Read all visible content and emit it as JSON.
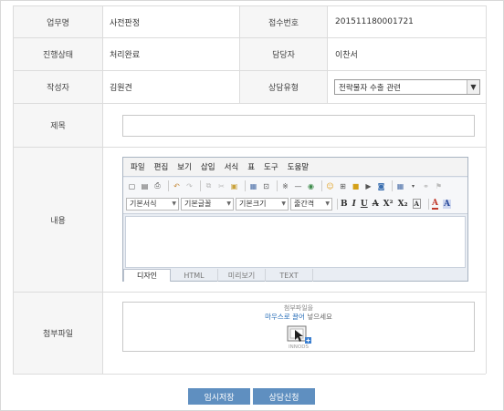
{
  "rows": {
    "work_name": {
      "label": "업무명",
      "value": "사전판정"
    },
    "receipt_no": {
      "label": "접수번호",
      "value": "20151118000172​1"
    },
    "status": {
      "label": "진행상태",
      "value": "처리완료"
    },
    "manager": {
      "label": "담당자",
      "value": "이찬서"
    },
    "writer": {
      "label": "작성자",
      "value": "김원견"
    },
    "consult_type": {
      "label": "상담유형",
      "value": "전략물자 수출 관련"
    },
    "title": {
      "label": "제목",
      "value": ""
    },
    "content": {
      "label": "내용"
    },
    "attach": {
      "label": "첨부파일"
    }
  },
  "editor": {
    "menu": [
      "파일",
      "편집",
      "보기",
      "삽입",
      "서식",
      "표",
      "도구",
      "도움말"
    ],
    "format_select": "기본서식",
    "font_select": "기본글꼴",
    "size_select": "기본크기",
    "line_select": "줄간격",
    "tabs": [
      "디자인",
      "HTML",
      "미리보기",
      "TEXT"
    ]
  },
  "attachment": {
    "box_title": "첨부파일을",
    "hint_blue": "마우스로 끌어",
    "hint_rest": " 넣으세요",
    "brand": "INNODS"
  },
  "buttons": {
    "temp_save": "임시저장",
    "apply": "상담신청"
  },
  "colors": {
    "button_bg": "#5f8fc0",
    "header_bg": "#f6f6f6",
    "link_blue": "#2a6fb8"
  }
}
